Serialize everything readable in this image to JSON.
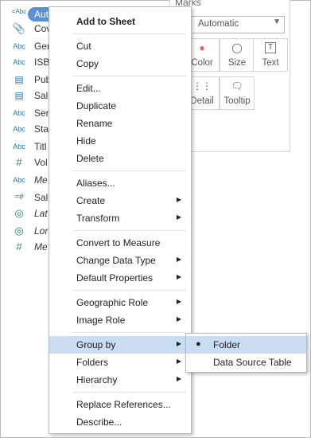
{
  "data_pane": {
    "selected_field": "Author Name",
    "fields": [
      {
        "icon": "=Abc",
        "label": "Author Name"
      },
      {
        "icon": "paperclip",
        "label": "Cov"
      },
      {
        "icon": "Abc",
        "label": "Gen"
      },
      {
        "icon": "Abc",
        "label": "ISB"
      },
      {
        "icon": "calendar",
        "label": "Pub"
      },
      {
        "icon": "calendar",
        "label": "Sal"
      },
      {
        "icon": "Abc",
        "label": "Ser"
      },
      {
        "icon": "Abc",
        "label": "Sta"
      },
      {
        "icon": "Abc",
        "label": "Titl"
      },
      {
        "icon": "#",
        "label": "Vol"
      },
      {
        "icon": "Abc",
        "label": "Me"
      },
      {
        "icon": "=#",
        "label": "Sal"
      },
      {
        "icon": "globe",
        "label": "Lat"
      },
      {
        "icon": "globe",
        "label": "Lor"
      },
      {
        "icon": "#",
        "label": "Me"
      }
    ]
  },
  "marks_card": {
    "title": "Marks",
    "mark_type": "Automatic",
    "buttons": [
      {
        "label": "Color"
      },
      {
        "label": "Size"
      },
      {
        "label": "Text"
      },
      {
        "label": "Detail"
      },
      {
        "label": "Tooltip"
      }
    ]
  },
  "context_menu": {
    "items": [
      {
        "label": "Add to Sheet"
      },
      {
        "label": "Cut"
      },
      {
        "label": "Copy"
      },
      {
        "label": "Edit..."
      },
      {
        "label": "Duplicate"
      },
      {
        "label": "Rename"
      },
      {
        "label": "Hide"
      },
      {
        "label": "Delete"
      },
      {
        "label": "Aliases..."
      },
      {
        "label": "Create"
      },
      {
        "label": "Transform"
      },
      {
        "label": "Convert to Measure"
      },
      {
        "label": "Change Data Type"
      },
      {
        "label": "Default Properties"
      },
      {
        "label": "Geographic Role"
      },
      {
        "label": "Image Role"
      },
      {
        "label": "Group by"
      },
      {
        "label": "Folders"
      },
      {
        "label": "Hierarchy"
      },
      {
        "label": "Replace References..."
      },
      {
        "label": "Describe..."
      }
    ]
  },
  "submenu": {
    "items": [
      {
        "label": "Folder",
        "selected": true
      },
      {
        "label": "Data Source Table",
        "selected": false
      }
    ]
  },
  "colors": {
    "selection_pill": "#5b8fd6",
    "hover_highlight": "#c9dcf2"
  }
}
